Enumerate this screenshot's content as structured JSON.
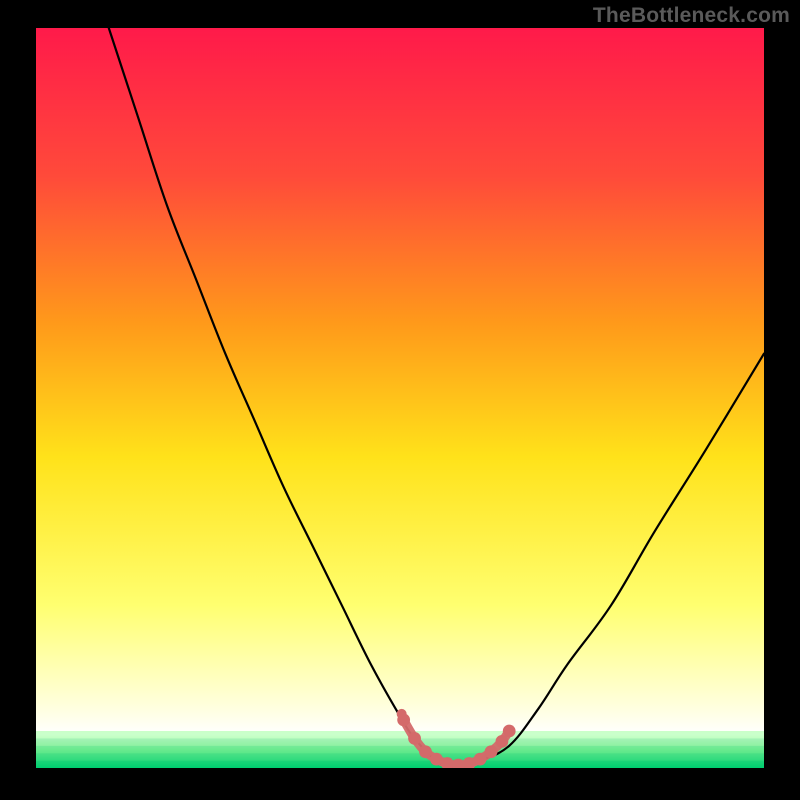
{
  "watermark": "TheBottleneck.com",
  "chart_data": {
    "type": "line",
    "title": "",
    "xlabel": "",
    "ylabel": "",
    "xlim": [
      0,
      100
    ],
    "ylim": [
      0,
      100
    ],
    "grid": false,
    "legend": false,
    "background_gradient": {
      "stops": [
        {
          "pos": 0.0,
          "color": "#ff1a4a"
        },
        {
          "pos": 0.2,
          "color": "#ff4a3a"
        },
        {
          "pos": 0.4,
          "color": "#ff9a1a"
        },
        {
          "pos": 0.58,
          "color": "#ffe21a"
        },
        {
          "pos": 0.78,
          "color": "#ffff70"
        },
        {
          "pos": 0.92,
          "color": "#ffffe0"
        },
        {
          "pos": 0.955,
          "color": "#ffffff"
        },
        {
          "pos": 0.975,
          "color": "#9effa0"
        },
        {
          "pos": 1.0,
          "color": "#00e070"
        }
      ]
    },
    "series": [
      {
        "name": "bottleneck-curve",
        "color": "#000000",
        "x": [
          10,
          14,
          18,
          22,
          26,
          30,
          34,
          38,
          42,
          46,
          50,
          52,
          55,
          58,
          61,
          65,
          69,
          73,
          79,
          85,
          92,
          100
        ],
        "y": [
          100,
          88,
          76,
          66,
          56,
          47,
          38,
          30,
          22,
          14,
          7,
          4,
          1,
          0,
          1,
          3,
          8,
          14,
          22,
          32,
          43,
          56
        ]
      }
    ],
    "marker_cluster": {
      "name": "optimal-region",
      "color": "#d46a6a",
      "points": [
        {
          "x": 50.5,
          "y": 6.5
        },
        {
          "x": 52.0,
          "y": 4.0
        },
        {
          "x": 53.5,
          "y": 2.2
        },
        {
          "x": 55.0,
          "y": 1.2
        },
        {
          "x": 56.5,
          "y": 0.6
        },
        {
          "x": 58.0,
          "y": 0.4
        },
        {
          "x": 59.5,
          "y": 0.6
        },
        {
          "x": 61.0,
          "y": 1.2
        },
        {
          "x": 62.5,
          "y": 2.2
        },
        {
          "x": 64.0,
          "y": 3.6
        },
        {
          "x": 65.0,
          "y": 5.0
        }
      ],
      "radius": 2.0
    },
    "green_band": {
      "y_from": 0,
      "y_to": 5
    }
  }
}
